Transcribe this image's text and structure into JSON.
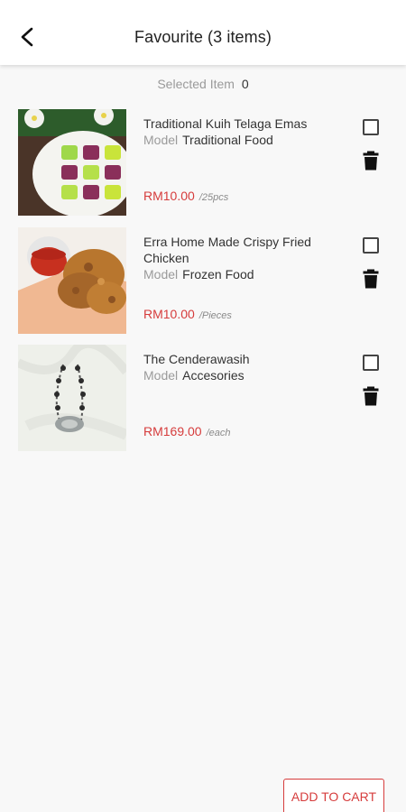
{
  "header": {
    "title": "Favourite (3 items)",
    "back_icon": "arrow-back-icon"
  },
  "selection": {
    "label": "Selected Item",
    "count": "0"
  },
  "items": [
    {
      "name": "Traditional Kuih Telaga Emas",
      "model_label": "Model",
      "model": "Traditional Food",
      "price": "RM10.00",
      "unit": "/25pcs",
      "checked": false
    },
    {
      "name": "Erra Home Made Crispy Fried Chicken",
      "model_label": "Model",
      "model": "Frozen Food",
      "price": "RM10.00",
      "unit": "/Pieces",
      "checked": false
    },
    {
      "name": "The Cenderawasih",
      "model_label": "Model",
      "model": "Accesories",
      "price": "RM169.00",
      "unit": "/each",
      "checked": false
    }
  ],
  "footer": {
    "add_to_cart_label": "ADD TO CART"
  },
  "colors": {
    "accent": "#d63c3c",
    "background": "#f8f8f8",
    "text": "#333333",
    "muted": "#9a9a9a"
  }
}
